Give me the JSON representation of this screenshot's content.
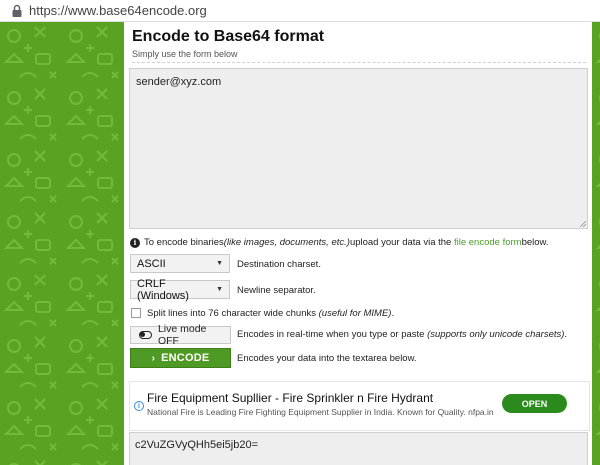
{
  "browser": {
    "url": "https://www.base64encode.org"
  },
  "page": {
    "title": "Encode to Base64 format",
    "subtitle": "Simply use the form below"
  },
  "input": {
    "value": "sender@xyz.com"
  },
  "info": {
    "prefix": "To encode binaries ",
    "italic": "(like images, documents, etc.)",
    "middle": " upload your data via the ",
    "link": "file encode form",
    "suffix": " below."
  },
  "charset": {
    "value": "ASCII",
    "label": "Destination charset."
  },
  "newline": {
    "value": "CRLF (Windows)",
    "label": "Newline separator."
  },
  "split": {
    "label_prefix": "Split lines into 76 character wide chunks ",
    "label_italic": "(useful for MIME)",
    "label_suffix": ".",
    "checked": false
  },
  "live": {
    "button_label": "Live mode OFF",
    "desc_prefix": "Encodes in real-time when you type or paste ",
    "desc_italic": "(supports only unicode charsets)",
    "desc_suffix": "."
  },
  "encode": {
    "button_label": "ENCODE",
    "chevron": "›",
    "desc": "Encodes your data into the textarea below."
  },
  "ad": {
    "badge": "i",
    "title": "Fire Equipment Supllier - Fire Sprinkler n Fire Hydrant",
    "desc": "National Fire is Leading Fire Fighting Equipment Supplier in India. Known for Quality. nfpa.in",
    "button": "OPEN"
  },
  "output": {
    "value": "c2VuZGVyQHh5ei5jb20="
  },
  "colors": {
    "brand_green": "#5aa322",
    "button_green": "#4f9a24",
    "link_green": "#4a9e2a",
    "ad_button": "#2b8a1c"
  },
  "icons": {
    "lock": "lock-icon",
    "info": "info-circle-icon",
    "toggle": "toggle-off-icon",
    "chevron": "chevron-right-icon",
    "caret": "caret-down-icon",
    "ad_info": "ad-info-icon"
  }
}
